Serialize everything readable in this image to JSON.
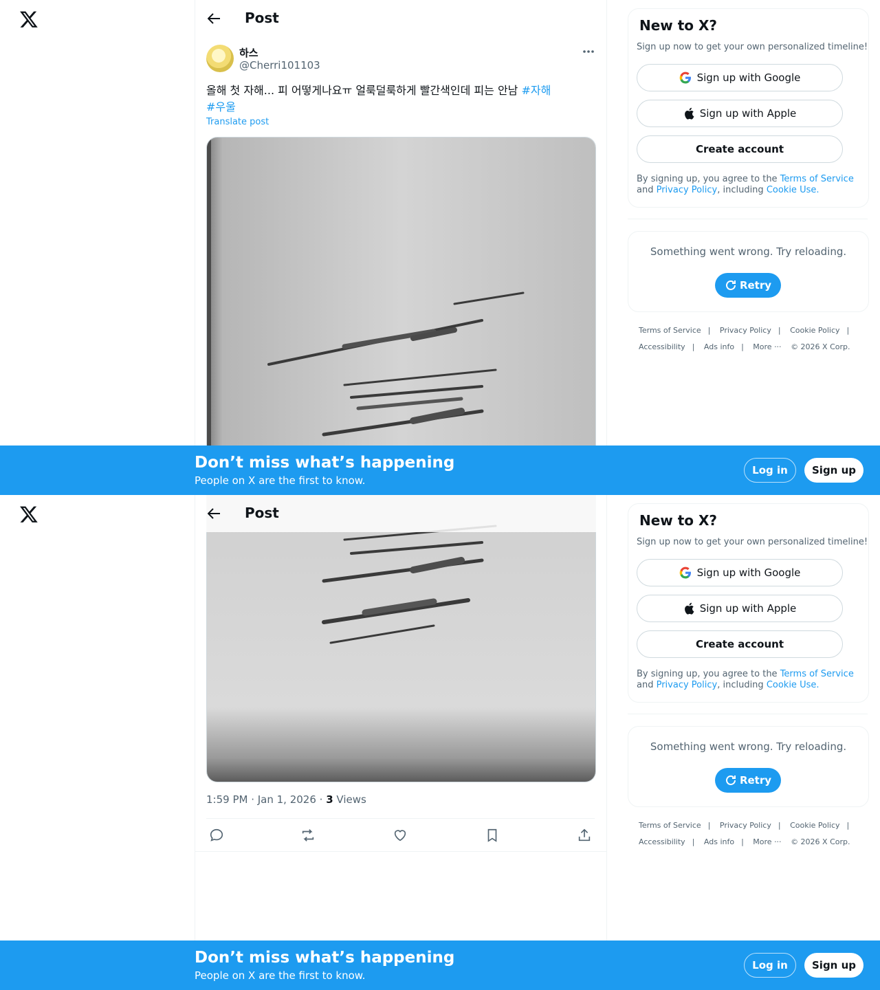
{
  "header": {
    "title": "Post"
  },
  "post": {
    "display_name": "하스",
    "handle": "@Cherri101103",
    "text": "올해 첫 자해... 피 어떻게나요ㅠ 얼룩덜룩하게 빨간색인데 피는 안남 ",
    "hashtags": [
      "#자해",
      "#우울"
    ],
    "translate_label": "Translate post",
    "time": "1:59 PM · Jan 1, 2026 · ",
    "views_count": "3",
    "views_label": " Views"
  },
  "actions": [
    "reply-icon",
    "repost-icon",
    "like-icon",
    "bookmark-icon",
    "share-icon"
  ],
  "signup_card": {
    "title": "New to X?",
    "subtitle": "Sign up now to get your own personalized timeline!",
    "google_label": "Sign up with Google",
    "apple_label": "Sign up with Apple",
    "create_label": "Create account",
    "terms_prefix": "By signing up, you agree to the ",
    "terms_link": "Terms of Service",
    "terms_and": " and ",
    "privacy_link": "Privacy Policy",
    "terms_including": ", including ",
    "cookie_link": "Cookie Use."
  },
  "error_card": {
    "message": "Something went wrong. Try reloading.",
    "retry_label": "Retry"
  },
  "footer": {
    "links_row1": [
      "Terms of Service",
      "Privacy Policy",
      "Cookie Policy"
    ],
    "links_row2": [
      "Accessibility",
      "Ads info",
      "More ···"
    ],
    "copyright": "© 2026 X Corp.",
    "separator": "|"
  },
  "banner": {
    "title": "Don’t miss what’s happening",
    "subtitle": "People on X are the first to know.",
    "login_label": "Log in",
    "signup_label": "Sign up"
  },
  "colors": {
    "accent": "#1d9bf0",
    "text": "#0f1419",
    "muted": "#536471",
    "border": "#eff3f4"
  }
}
